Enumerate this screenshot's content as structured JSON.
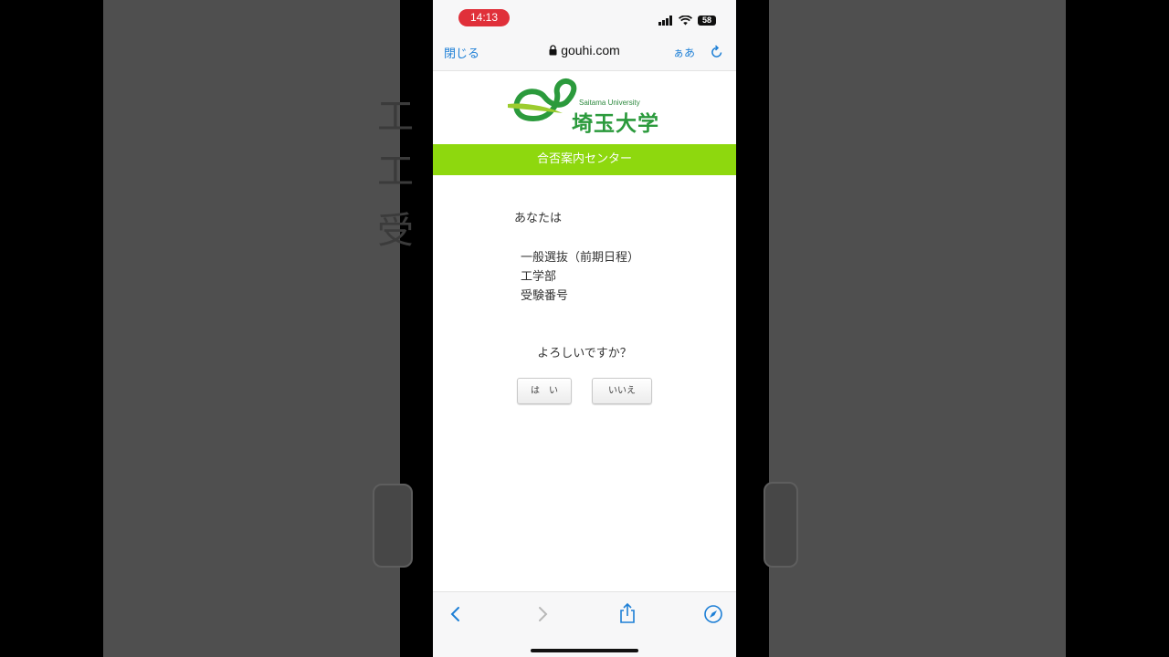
{
  "status_bar": {
    "time": "14:13",
    "battery": "58"
  },
  "browser": {
    "close_label": "閉じる",
    "url": "gouhi.com",
    "text_size_label": "ぁあ"
  },
  "logo": {
    "english": "Saitama University",
    "japanese": "埼玉大学"
  },
  "site": {
    "header": "合否案内センター"
  },
  "content": {
    "you_are": "あなたは",
    "selection_type": "一般選抜（前期日程）",
    "faculty": "工学部",
    "exam_number_label": "受験番号",
    "confirm_question": "よろしいですか？",
    "yes_label": "は　い",
    "no_label": "いいえ"
  },
  "background": {
    "ghost_chars": [
      "工",
      "工",
      "受"
    ]
  },
  "colors": {
    "brand_green": "#8ed80e",
    "logo_green": "#2b9a3c",
    "ios_link": "#1d7fd6",
    "recording_pill": "#e0303a"
  },
  "icons": [
    "lock-icon",
    "reload-icon",
    "back-icon",
    "forward-icon",
    "share-icon",
    "compass-icon",
    "signal-icon",
    "wifi-icon",
    "battery-icon"
  ]
}
